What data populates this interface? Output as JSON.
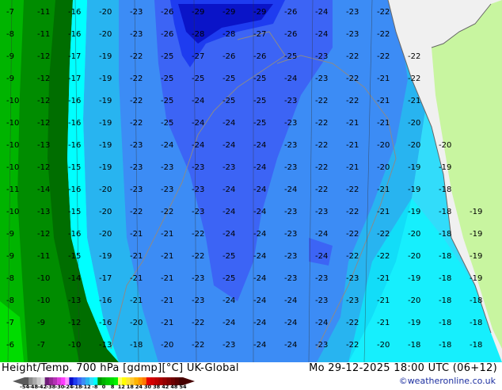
{
  "title": "Height/Temp. 700 hPa [gdmp][°C] UK-Global",
  "datetime": "Mo 29-12-2025 18:00 UTC (06+12)",
  "credit": "©weatheronline.co.uk",
  "colorbar": {
    "ticks": [
      "-54",
      "-48",
      "-42",
      "-38",
      "-30",
      "-24",
      "-18",
      "-12",
      "-8",
      "0",
      "8",
      "12",
      "18",
      "24",
      "30",
      "38",
      "42",
      "48",
      "54"
    ],
    "colors": [
      "#5a5a5a",
      "#8c8c8c",
      "#aaaaaa",
      "#c8c8c8",
      "#e1e1e1",
      "#6e1e78",
      "#962896",
      "#b432b4",
      "#dc3cdc",
      "#ff3cff",
      "#ff96ff",
      "#0a0ac8",
      "#1e3cf0",
      "#3c64f5",
      "#3c8cf5",
      "#28b4f0",
      "#32dcfa",
      "#00ffff",
      "#009600",
      "#00b400",
      "#00c800",
      "#00dc00",
      "#00f000",
      "#ffff64",
      "#ffff00",
      "#ffe632",
      "#ffc832",
      "#ffb400",
      "#ff9600",
      "#ff7800",
      "#e60000",
      "#d20000",
      "#be0000",
      "#aa0000",
      "#960000",
      "#820000",
      "#6e0000",
      "#5a0000",
      "#460000"
    ]
  },
  "field_colors": {
    "no_data": "#f0f0f0",
    "land": "#c8f5a0"
  },
  "isotherm_labels": [
    [
      -7,
      -11,
      -16,
      -20,
      -23,
      -26,
      -29,
      -29,
      -29,
      -26,
      -24,
      -23,
      -22,
      null,
      null,
      null
    ],
    [
      -8,
      -11,
      -16,
      -20,
      -23,
      -26,
      -28,
      -28,
      -27,
      -26,
      -24,
      -23,
      -22,
      null,
      null,
      null
    ],
    [
      -9,
      -12,
      -17,
      -19,
      -22,
      -25,
      -27,
      -26,
      -26,
      -25,
      -23,
      -22,
      -22,
      -22,
      null,
      null
    ],
    [
      -9,
      -12,
      -17,
      -19,
      -22,
      -25,
      -25,
      -25,
      -25,
      -24,
      -23,
      -22,
      -21,
      -22,
      null,
      null
    ],
    [
      -10,
      -12,
      -16,
      -19,
      -22,
      -25,
      -24,
      -25,
      -25,
      -23,
      -22,
      -22,
      -21,
      -21,
      null,
      null
    ],
    [
      -10,
      -12,
      -16,
      -19,
      -22,
      -25,
      -24,
      -24,
      -25,
      -23,
      -22,
      -21,
      -21,
      -20,
      null,
      null
    ],
    [
      -10,
      -13,
      -16,
      -19,
      -23,
      -24,
      -24,
      -24,
      -24,
      -23,
      -22,
      -21,
      -20,
      -20,
      -20,
      null
    ],
    [
      -10,
      -12,
      -15,
      -19,
      -23,
      -23,
      -23,
      -23,
      -24,
      -23,
      -22,
      -21,
      -20,
      -19,
      -19,
      null
    ],
    [
      -11,
      -14,
      -16,
      -20,
      -23,
      -23,
      -23,
      -24,
      -24,
      -24,
      -22,
      -22,
      -21,
      -19,
      -18,
      null
    ],
    [
      -10,
      -13,
      -15,
      -20,
      -22,
      -22,
      -23,
      -24,
      -24,
      -23,
      -23,
      -22,
      -21,
      -19,
      -18,
      -19
    ],
    [
      -9,
      -12,
      -16,
      -20,
      -21,
      -21,
      -22,
      -24,
      -24,
      -23,
      -24,
      -22,
      -22,
      -20,
      -18,
      -19
    ],
    [
      -9,
      -11,
      -15,
      -19,
      -21,
      -21,
      -22,
      -25,
      -24,
      -23,
      -24,
      -22,
      -22,
      -20,
      -18,
      -19
    ],
    [
      -8,
      -10,
      -14,
      -17,
      -21,
      -21,
      -23,
      -25,
      -24,
      -23,
      -23,
      -23,
      -21,
      -19,
      -18,
      -19
    ],
    [
      -8,
      -10,
      -13,
      -16,
      -21,
      -21,
      -23,
      -24,
      -24,
      -24,
      -23,
      -23,
      -21,
      -20,
      -18,
      -18
    ],
    [
      -7,
      -9,
      -12,
      -16,
      -20,
      -21,
      -22,
      -24,
      -24,
      -24,
      -24,
      -22,
      -21,
      -19,
      -18,
      -18
    ],
    [
      -6,
      -7,
      -10,
      -13,
      -18,
      -20,
      -22,
      -23,
      -24,
      -24,
      -23,
      -22,
      -20,
      -18,
      -18,
      -18
    ]
  ]
}
